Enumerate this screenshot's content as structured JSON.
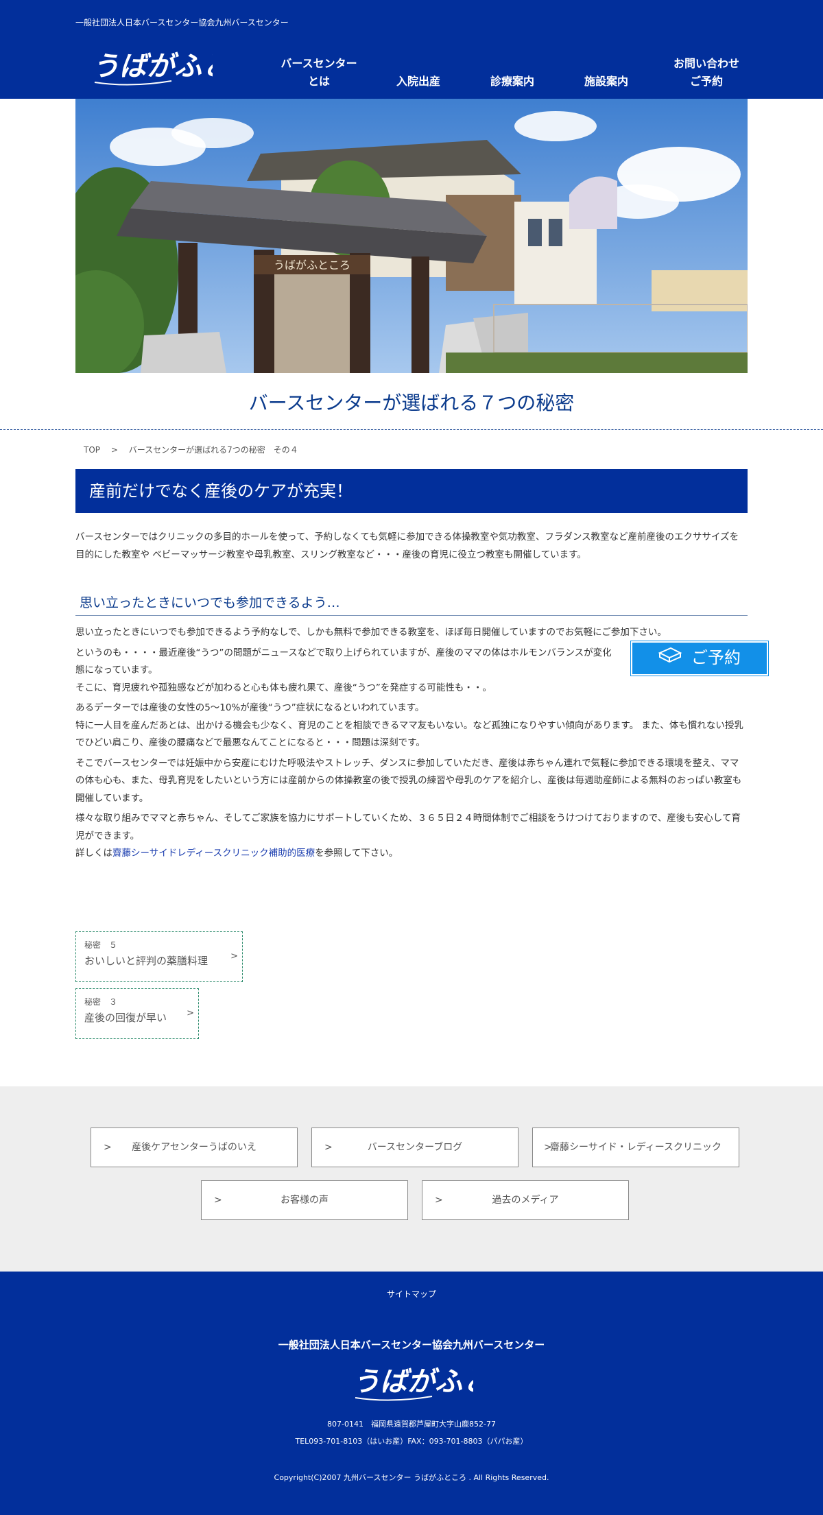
{
  "header": {
    "org_name": "一般社団法人日本バースセンター協会九州バースセンター",
    "logo_text": "うばがふところ",
    "nav": [
      {
        "line1": "バースセンター",
        "line2": "とは"
      },
      {
        "line1": "",
        "line2": "入院出産"
      },
      {
        "line1": "",
        "line2": "診療案内"
      },
      {
        "line1": "",
        "line2": "施設案内"
      },
      {
        "line1": "お問い合わせ",
        "line2": "ご予約"
      }
    ]
  },
  "hero": {
    "sign_text": "うばがふところ"
  },
  "page_title": "バースセンターが選ばれる７つの秘密",
  "breadcrumb": {
    "items": [
      "TOP",
      ">",
      "バースセンターが選ばれる7つの秘密　その４"
    ]
  },
  "banner": "産前だけでなく産後のケアが充実！",
  "intro": [
    "バースセンターではクリニックの多目的ホールを使って、予約しなくても気軽に参加できる体操教室や気功教室、フラダンス教室など産前産後のエクササイズを目的にした教室や ベビーマッサージ教室や母乳教室、スリング教室など・・・産後の育児に役立つ教室も開催しています。"
  ],
  "subhead": "思い立ったときにいつでも参加できるよう…",
  "body": {
    "p1": "思い立ったときにいつでも参加できるよう予約なしで、しかも無料で参加できる教室を、ほぼ毎日開催していますのでお気軽にご参加下さい。",
    "p2": "というのも・・・・最近産後“うつ”の問題がニュースなどで取り上げられていますが、産後のママの体はホルモンバランスが変化",
    "p3": "態になっています。",
    "p4": "そこに、育児疲れや孤独感などが加わると心も体も疲れ果て、産後“うつ”を発症する可能性も・・。",
    "p5": "あるデーターでは産後の女性の5～10%が産後“うつ”症状になるといわれています。",
    "p6": "特に一人目を産んだあとは、出かける機会も少なく、育児のことを相談できるママ友もいない。など孤独になりやすい傾向があります。 また、体も慣れない授乳でひどい肩こり、産後の腰痛などで最悪なんてことになると・・・問題は深刻です。",
    "p7": "そこでバースセンターでは妊娠中から安産にむけた呼吸法やストレッチ、ダンスに参加していただき、産後は赤ちゃん連れで気軽に参加できる環境を整え、ママの体も心も、また、母乳育児をしたいという方には産前からの体操教室の後で授乳の練習や母乳のケアを紹介し、産後は毎週助産師による無料のおっぱい教室も開催しています。",
    "p8": "様々な取り組みでママと赤ちゃん、そしてご家族を協力にサポートしていくため、３６５日２４時間体制でご相談をうけつけておりますので、産後も安心して育児ができます。",
    "p9_pre": "詳しくは",
    "p9_link": "齋藤シーサイドレディースクリニック補助的医療",
    "p9_post": "を参照して下さい。"
  },
  "reserve_button": "ご予約",
  "secret_links": [
    {
      "num": "秘密　５",
      "title": "おいしいと評判の薬膳料理",
      "arrow": ">"
    },
    {
      "num": "秘密　３",
      "title": "産後の回復が早い",
      "arrow": ">"
    }
  ],
  "related_links": [
    {
      "gt": ">",
      "label": "産後ケアセンターうばのいえ"
    },
    {
      "gt": ">",
      "label": "バースセンターブログ"
    },
    {
      "gt": ">",
      "label": "齋藤シーサイド・レディースクリニック"
    },
    {
      "gt": ">",
      "label": "お客様の声"
    },
    {
      "gt": ">",
      "label": "過去のメディア"
    }
  ],
  "footer": {
    "sitemap": "サイトマップ",
    "org_name": "一般社団法人日本バースセンター協会九州バースセンター",
    "logo_text": "うばがふところ",
    "address": "807-0141　福岡県遠賀郡芦屋町大字山鹿852-77",
    "tel": "TEL093-701-8103（はいお産）FAX：093-701-8803（パパお産）",
    "copyright": "Copyright(C)2007 九州バースセンター うばがふところ . All Rights Reserved."
  },
  "colors": {
    "brand_blue": "#022f9b",
    "title_blue": "#0a3a8c",
    "reserve_blue": "#1290e8",
    "gray_band": "#eeeeee"
  }
}
